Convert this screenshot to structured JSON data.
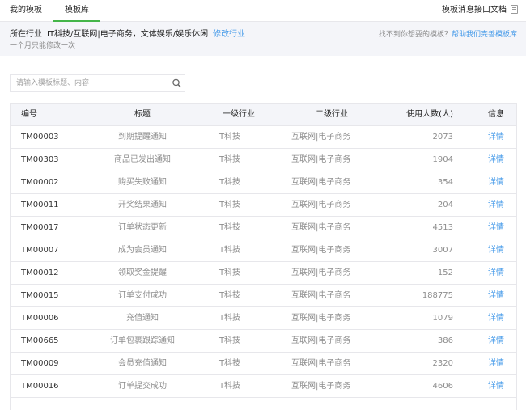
{
  "tabs": {
    "mine": "我的模板",
    "library": "模板库"
  },
  "doc_link": "模板消息接口文档",
  "industry": {
    "label": "所在行业",
    "value": "IT科技/互联网|电子商务，文体娱乐/娱乐休闲",
    "modify": "修改行业",
    "note": "一个月只能修改一次"
  },
  "help": {
    "text": "找不到你想要的模板？",
    "link": "帮助我们完善模板库"
  },
  "search": {
    "placeholder": "请输入模板标题、内容"
  },
  "table": {
    "headers": {
      "id": "编号",
      "title": "标题",
      "ind1": "一级行业",
      "ind2": "二级行业",
      "users": "使用人数(人)",
      "info": "信息"
    },
    "rows": [
      {
        "id": "TM00003",
        "title": "到期提醒通知",
        "ind1": "IT科技",
        "ind2": "互联网|电子商务",
        "users": "2073",
        "info": "详情"
      },
      {
        "id": "TM00303",
        "title": "商品已发出通知",
        "ind1": "IT科技",
        "ind2": "互联网|电子商务",
        "users": "1904",
        "info": "详情"
      },
      {
        "id": "TM00002",
        "title": "购买失败通知",
        "ind1": "IT科技",
        "ind2": "互联网|电子商务",
        "users": "354",
        "info": "详情"
      },
      {
        "id": "TM00011",
        "title": "开奖结果通知",
        "ind1": "IT科技",
        "ind2": "互联网|电子商务",
        "users": "204",
        "info": "详情"
      },
      {
        "id": "TM00017",
        "title": "订单状态更新",
        "ind1": "IT科技",
        "ind2": "互联网|电子商务",
        "users": "4513",
        "info": "详情"
      },
      {
        "id": "TM00007",
        "title": "成为会员通知",
        "ind1": "IT科技",
        "ind2": "互联网|电子商务",
        "users": "3007",
        "info": "详情"
      },
      {
        "id": "TM00012",
        "title": "领取奖金提醒",
        "ind1": "IT科技",
        "ind2": "互联网|电子商务",
        "users": "152",
        "info": "详情"
      },
      {
        "id": "TM00015",
        "title": "订单支付成功",
        "ind1": "IT科技",
        "ind2": "互联网|电子商务",
        "users": "188775",
        "info": "详情"
      },
      {
        "id": "TM00006",
        "title": "充值通知",
        "ind1": "IT科技",
        "ind2": "互联网|电子商务",
        "users": "1079",
        "info": "详情"
      },
      {
        "id": "TM00665",
        "title": "订单包裹跟踪通知",
        "ind1": "IT科技",
        "ind2": "互联网|电子商务",
        "users": "386",
        "info": "详情"
      },
      {
        "id": "TM00009",
        "title": "会员充值通知",
        "ind1": "IT科技",
        "ind2": "互联网|电子商务",
        "users": "2320",
        "info": "详情"
      },
      {
        "id": "TM00016",
        "title": "订单提交成功",
        "ind1": "IT科技",
        "ind2": "互联网|电子商务",
        "users": "4606",
        "info": "详情"
      }
    ]
  }
}
